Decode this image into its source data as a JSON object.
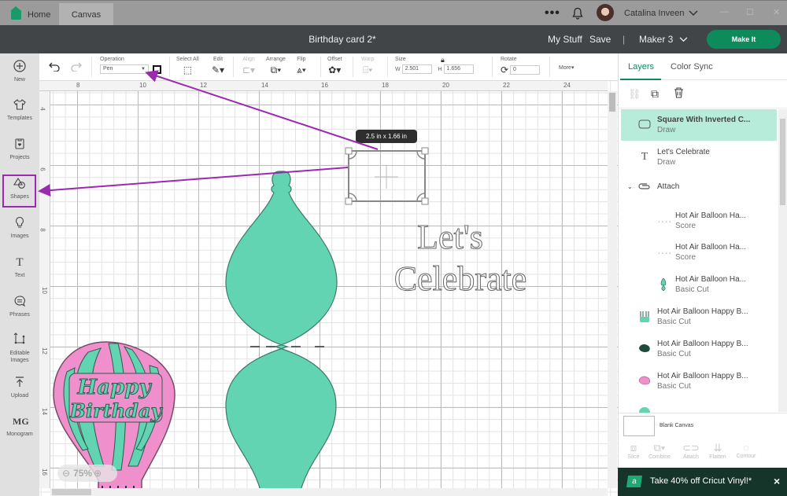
{
  "titlebar": {
    "tabs": [
      {
        "label": "Home",
        "icon": "home-icon"
      },
      {
        "label": "Canvas"
      }
    ],
    "more_icon": "•••",
    "user_name": "Catalina Inveen"
  },
  "header": {
    "title": "Birthday card 2*",
    "my_stuff": "My Stuff",
    "save": "Save",
    "separator": "|",
    "machine": "Maker 3",
    "make_it": "Make It"
  },
  "sidebar": {
    "items": [
      {
        "label": "New",
        "icon": "plus-circle-icon"
      },
      {
        "label": "Templates",
        "icon": "shirt-icon"
      },
      {
        "label": "Projects",
        "icon": "projects-icon"
      },
      {
        "label": "Shapes",
        "icon": "shapes-icon"
      },
      {
        "label": "Images",
        "icon": "lightbulb-icon"
      },
      {
        "label": "Text",
        "icon": "text-icon"
      },
      {
        "label": "Phrases",
        "icon": "speech-bubble-icon"
      },
      {
        "label": "Editable Images",
        "icon": "editable-images-icon"
      },
      {
        "label": "Upload",
        "icon": "upload-icon"
      },
      {
        "label": "Monogram",
        "icon": "monogram-icon"
      }
    ]
  },
  "toolbar": {
    "operation_label": "Operation",
    "operation_value": "Pen",
    "select_all": "Select All",
    "edit": "Edit",
    "align": "Align",
    "arrange": "Arrange",
    "flip": "Flip",
    "offset": "Offset",
    "warp": "Warp",
    "size": "Size",
    "w_label": "W",
    "w_value": "2.501",
    "h_label": "H",
    "h_value": "1.656",
    "rotate": "Rotate",
    "rotate_value": "0",
    "more": "More"
  },
  "ruler": {
    "h": [
      "8",
      "10",
      "12",
      "14",
      "16",
      "18",
      "20",
      "22",
      "24"
    ],
    "v": [
      "4",
      "6",
      "8",
      "10",
      "12",
      "14",
      "16"
    ]
  },
  "canvas": {
    "tooltip": "2.5  in x 1.66  in",
    "text_line1": "Let's",
    "text_line2": "Celebrate",
    "balloon_text1": "Happy",
    "balloon_text2": "Birthday",
    "zoom": "75%",
    "colors": {
      "mint": "#62d4b2",
      "pink": "#ef8fcb",
      "arrow": "#9c2ab0"
    }
  },
  "panel": {
    "tabs": [
      "Layers",
      "Color Sync"
    ],
    "layers": [
      {
        "name": "Square With Inverted C...",
        "type": "Draw",
        "icon": "rounded-rect-icon",
        "selected": true
      },
      {
        "name": "Let's Celebrate",
        "type": "Draw",
        "icon": "text-T-icon"
      },
      {
        "name": "Attach",
        "type": "",
        "icon": "attach-icon",
        "group": true
      },
      {
        "name": "Hot Air Balloon Ha...",
        "type": "Score",
        "icon": "score-line-icon"
      },
      {
        "name": "Hot Air Balloon Ha...",
        "type": "Score",
        "icon": "score-line-icon"
      },
      {
        "name": "Hot Air Balloon Ha...",
        "type": "Basic Cut",
        "icon": "balloon-part-icon"
      },
      {
        "name": "Hot Air Balloon Happy B...",
        "type": "Basic Cut",
        "icon": "basket-icon"
      },
      {
        "name": "Hot Air Balloon Happy B...",
        "type": "Basic Cut",
        "icon": "dark-shape-icon"
      },
      {
        "name": "Hot Air Balloon Happy B...",
        "type": "Basic Cut",
        "icon": "pink-shape-icon"
      }
    ],
    "blank_canvas": "Blank Canvas",
    "actions": [
      "Slice",
      "Combine",
      "Attach",
      "Flatten",
      "Contour"
    ]
  },
  "promo": {
    "text": "Take 40% off Cricut Vinyl!*",
    "badge": "a",
    "close": "×"
  }
}
